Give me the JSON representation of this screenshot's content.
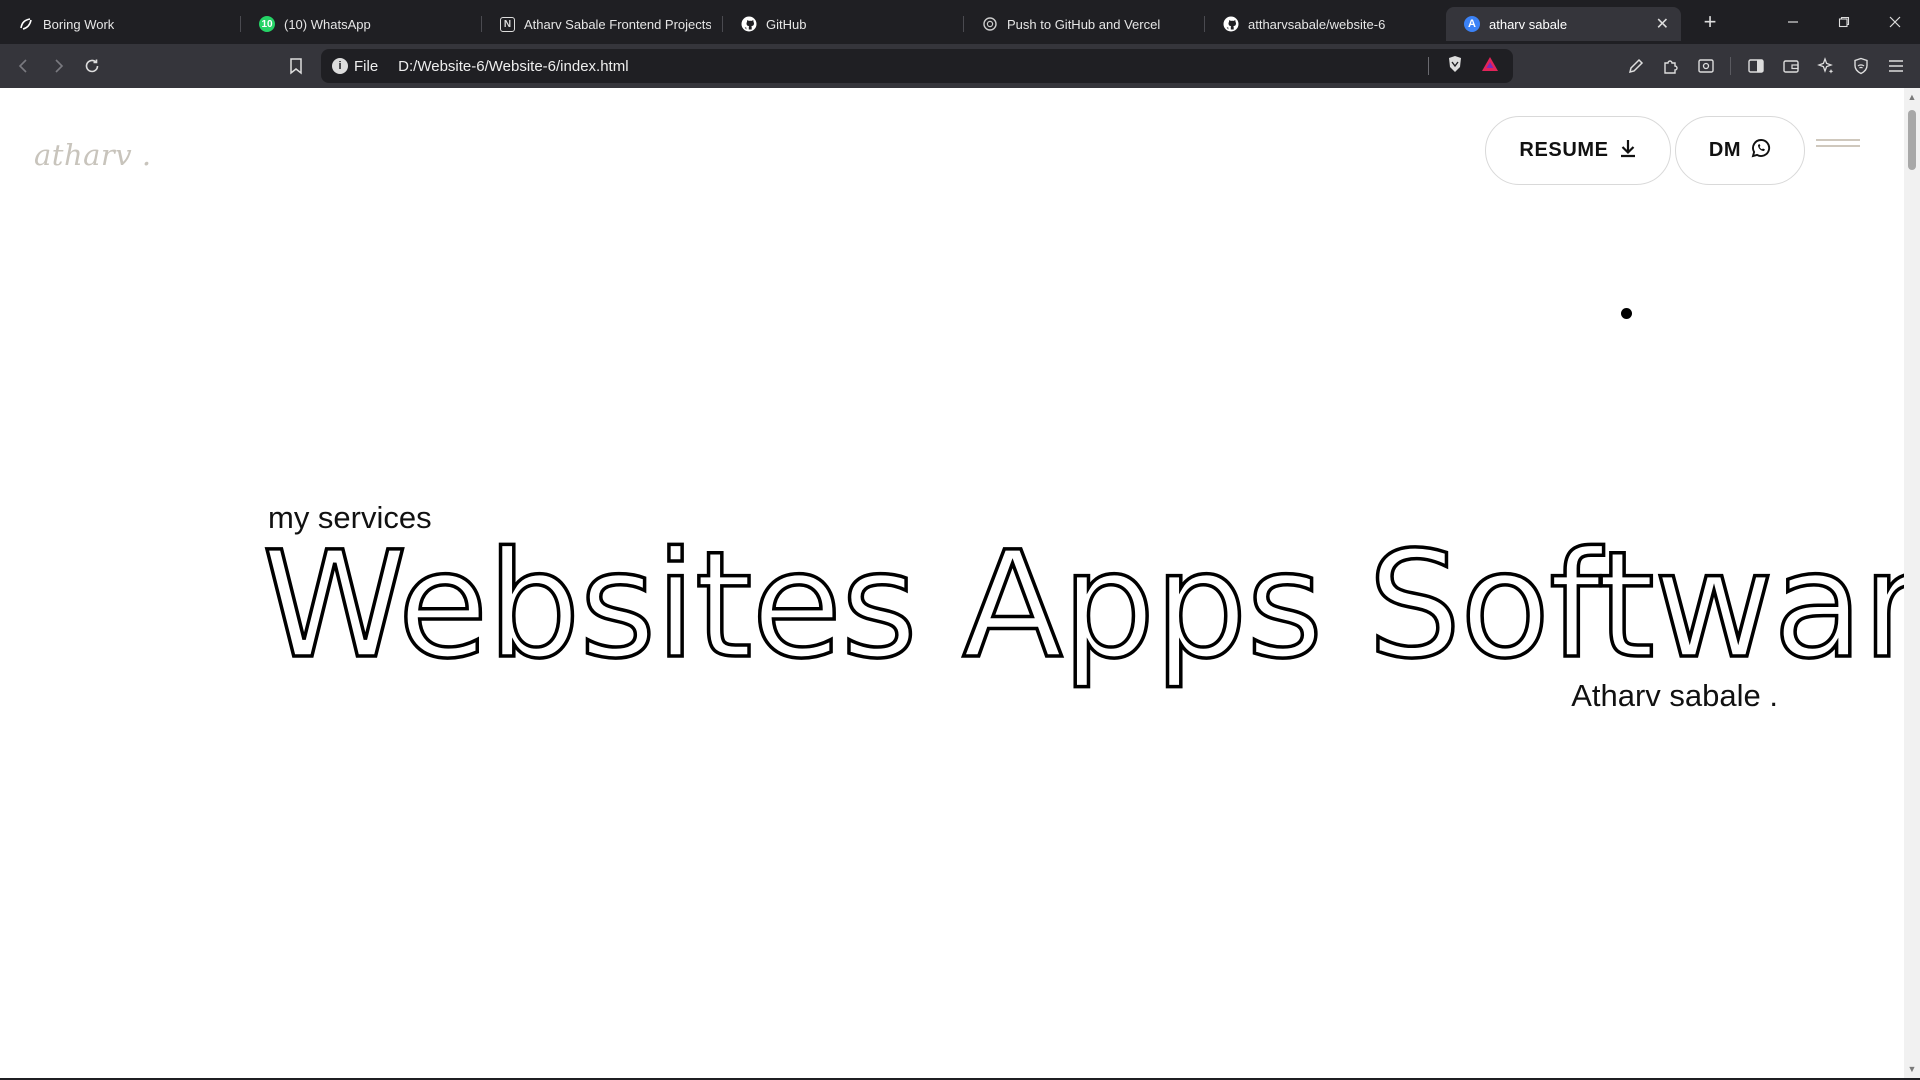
{
  "browser": {
    "tabs": [
      {
        "title": "Boring Work",
        "icon": "boring-work-icon"
      },
      {
        "title": "(10) WhatsApp",
        "icon": "whatsapp-icon",
        "badge": "10"
      },
      {
        "title": "Atharv Sabale Frontend Projects",
        "icon": "notion-icon"
      },
      {
        "title": "GitHub",
        "icon": "github-icon"
      },
      {
        "title": "Push to GitHub and Vercel",
        "icon": "chatgpt-icon"
      },
      {
        "title": "attharvsabale/website-6",
        "icon": "github-icon"
      },
      {
        "title": "atharv sabale",
        "icon": "site-a-icon",
        "active": true
      }
    ],
    "address": {
      "scheme_label": "File",
      "url": "D:/Website-6/Website-6/index.html"
    }
  },
  "page": {
    "logo": "atharv .",
    "buttons": {
      "resume": "RESUME",
      "dm": "DM"
    },
    "subtitle": "my services",
    "headline": "Websites Apps Software",
    "signature": "Atharv sabale ."
  },
  "colors": {
    "chrome_dark": "#1f1f23",
    "toolbar": "#35353b",
    "logo": "#c8c4bc",
    "whatsapp_green": "#25d366",
    "site_icon_blue": "#3b82f6"
  }
}
